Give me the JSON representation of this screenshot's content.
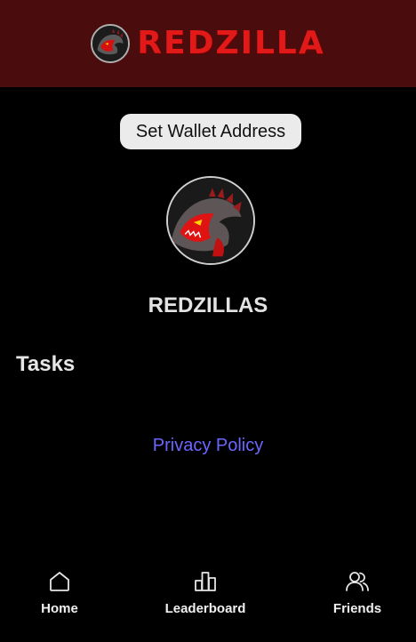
{
  "header": {
    "brand_text": "REDZILLA",
    "logo_icon": "redzilla-logo-icon"
  },
  "wallet": {
    "button_label": "Set Wallet Address"
  },
  "profile": {
    "avatar_icon": "redzilla-avatar-icon",
    "username": "REDZILLAS"
  },
  "tasks": {
    "heading": "Tasks"
  },
  "footer": {
    "privacy_link": "Privacy Policy"
  },
  "nav": {
    "items": [
      {
        "label": "Home",
        "icon": "home-icon"
      },
      {
        "label": "Leaderboard",
        "icon": "leaderboard-icon"
      },
      {
        "label": "Friends",
        "icon": "friends-icon"
      }
    ]
  },
  "colors": {
    "header_bg": "#4a0c0c",
    "brand_red": "#e11919",
    "link_blue": "#6b66ff",
    "button_bg": "#ebebeb",
    "page_bg": "#000000"
  }
}
